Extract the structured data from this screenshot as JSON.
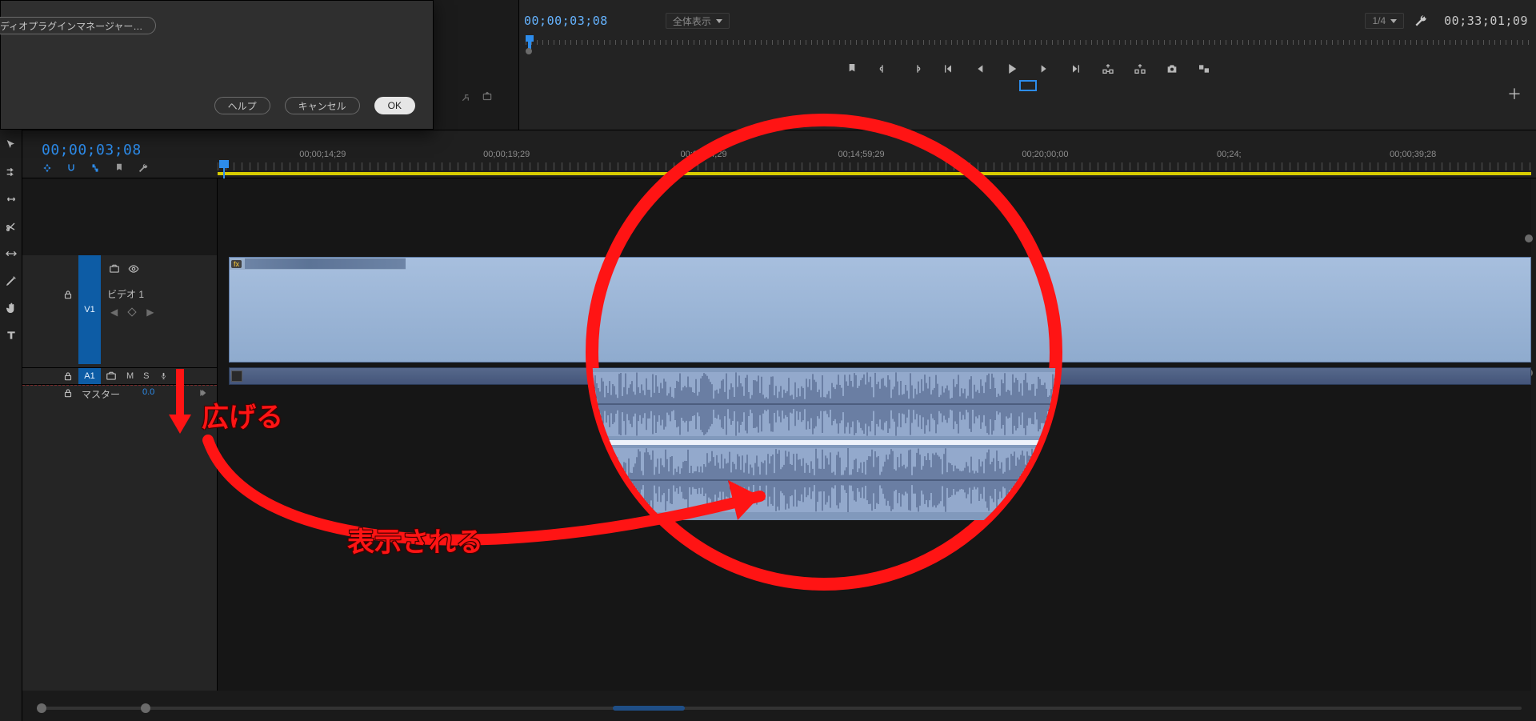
{
  "dialog": {
    "plugin_manager_label": "ーディオプラグインマネージャー…",
    "help_label": "ヘルプ",
    "cancel_label": "キャンセル",
    "ok_label": "OK"
  },
  "monitor": {
    "timecode_left": "00;00;03;08",
    "fit_label": "全体表示",
    "resolution_label": "1/4",
    "timecode_right": "00;33;01;09"
  },
  "timeline": {
    "timecode": "00;00;03;08",
    "ruler_labels": [
      "00;00;14;29",
      "00;00;19;29",
      "00;00;24;29",
      "00;14;59;29",
      "00;20;00;00",
      "00;24;",
      "00;00;39;28"
    ],
    "ruler_positions_pct": [
      8,
      22,
      37,
      49,
      63,
      77,
      91
    ],
    "video_track_target": "V1",
    "video_track_name": "ビデオ 1",
    "audio_track_target": "A1",
    "audio_mute": "M",
    "audio_solo": "S",
    "master_label": "マスター",
    "master_value": "0.0",
    "fx_badge": "fx"
  },
  "annotations": {
    "expand_label": "広げる",
    "shown_label": "表示される"
  }
}
